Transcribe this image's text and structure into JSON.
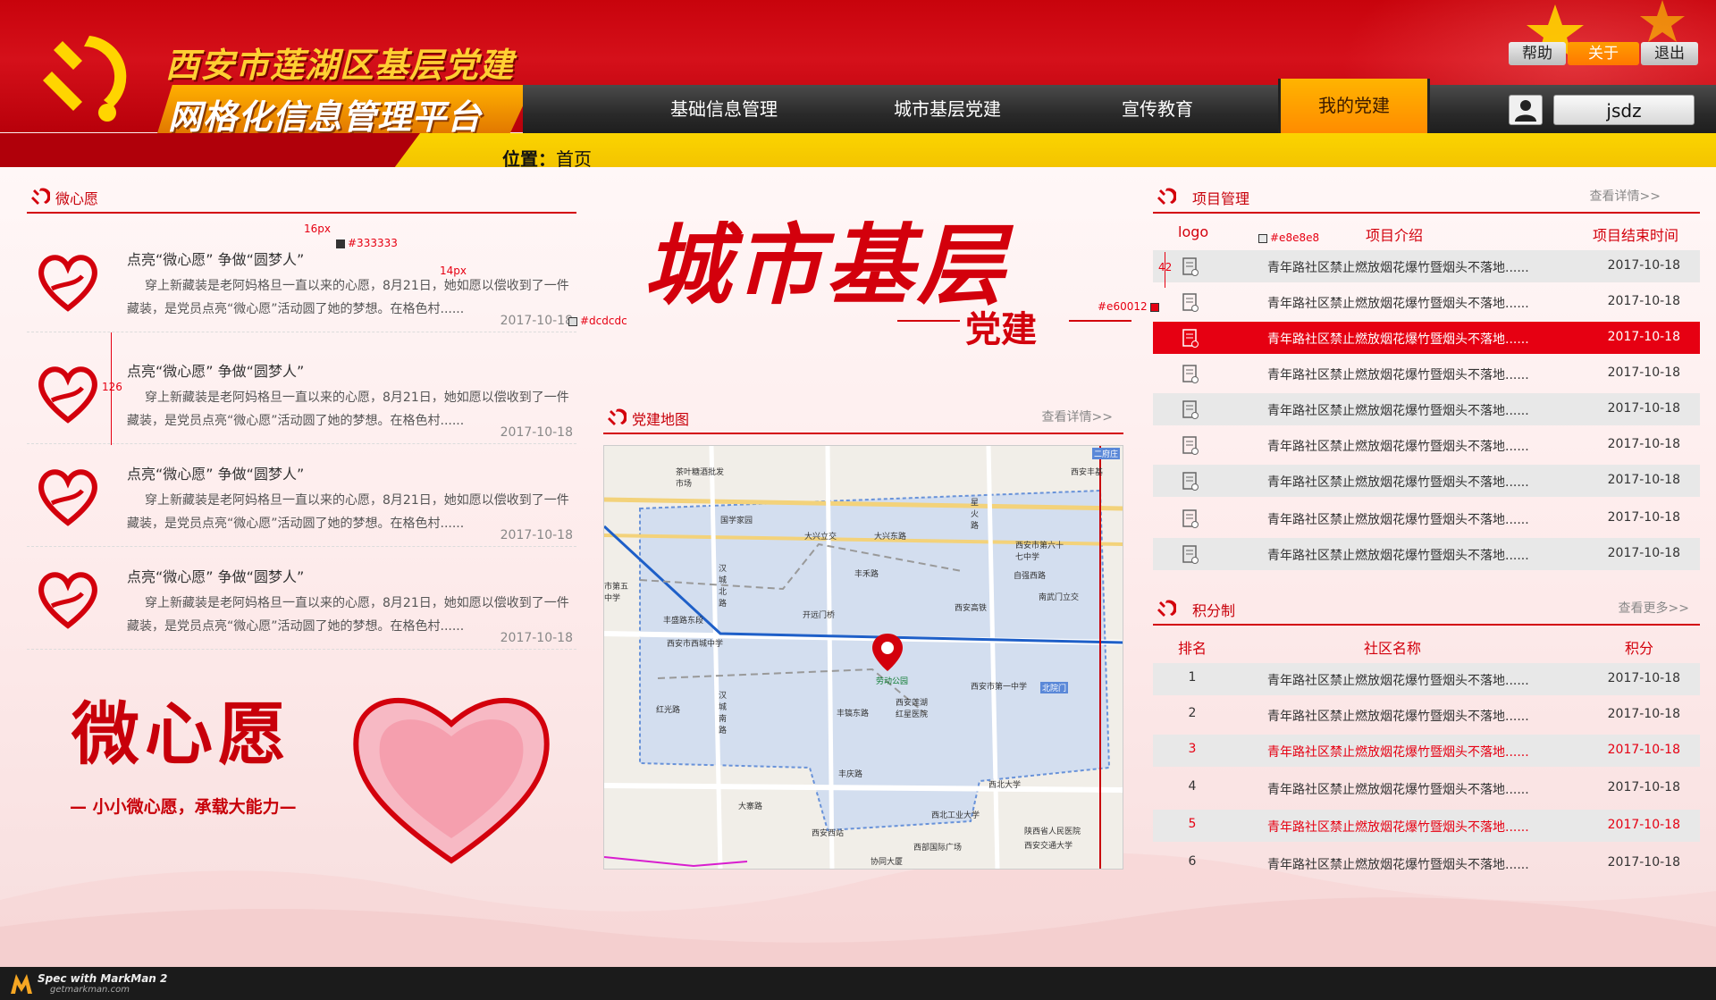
{
  "header": {
    "title_line1": "西安市莲湖区基层党建",
    "title_line2": "网格化信息管理平台",
    "nav": [
      "基础信息管理",
      "城市基层党建",
      "宣传教育",
      "我的党建"
    ],
    "top_buttons": {
      "help": "帮助",
      "about": "关于",
      "exit": "退出"
    },
    "username": "jsdz"
  },
  "location": {
    "label": "位置",
    "separator": "：",
    "value": "首页"
  },
  "wish": {
    "title": "微心愿",
    "items": [
      {
        "title": "点亮“微心愿” 争做“圆梦人”",
        "desc": "穿上新藏装是老阿妈格旦一直以来的心愿，8月21日，她如愿以偿收到了一件藏装，是党员点亮“微心愿”活动圆了她的梦想。在格色村......",
        "date": "2017-10-18"
      },
      {
        "title": "点亮“微心愿” 争做“圆梦人”",
        "desc": "穿上新藏装是老阿妈格旦一直以来的心愿，8月21日，她如愿以偿收到了一件藏装，是党员点亮“微心愿”活动圆了她的梦想。在格色村......",
        "date": "2017-10-18"
      },
      {
        "title": "点亮“微心愿” 争做“圆梦人”",
        "desc": "穿上新藏装是老阿妈格旦一直以来的心愿，8月21日，她如愿以偿收到了一件藏装，是党员点亮“微心愿”活动圆了她的梦想。在格色村......",
        "date": "2017-10-18"
      },
      {
        "title": "点亮“微心愿” 争做“圆梦人”",
        "desc": "穿上新藏装是老阿妈格旦一直以来的心愿，8月21日，她如愿以偿收到了一件藏装，是党员点亮“微心愿”活动圆了她的梦想。在格色村......",
        "date": "2017-10-18"
      }
    ],
    "banner_title": "微心愿",
    "banner_slogan": "— 小小微心愿，承载大能力—"
  },
  "center": {
    "big_title": "城市基层",
    "big_subtitle": "党建",
    "map_title": "党建地图",
    "map_more": "查看详情>>",
    "map_labels": [
      "茶叶糖酒批发市场",
      "国学家园",
      "大兴东路",
      "星火路",
      "西安市第六十七中学",
      "汉城北路",
      "丰禾路",
      "开远门桥",
      "自强西路",
      "西安高铁",
      "南武门立交",
      "丰盛路东段",
      "西安市西城中学",
      "劳动公园",
      "西安市第一中学",
      "北院门",
      "红光路",
      "汉城南路",
      "丰镐东路",
      "西安莲湖红星医院",
      "丰庆路",
      "大寨路",
      "西北工业大学",
      "西北大学",
      "西安交通大学",
      "陕西省人民医院",
      "二府庄",
      "西安丰基",
      "大兴立交",
      "市第五中学",
      "协同大厦",
      "西部国际广场",
      "西安西站"
    ]
  },
  "projects": {
    "title": "项目管理",
    "more": "查看详情>>",
    "headers": [
      "logo",
      "项目介绍",
      "项目结束时间"
    ],
    "rows": [
      {
        "text": "青年路社区禁止燃放烟花爆竹暨烟头不落地......",
        "date": "2017-10-18"
      },
      {
        "text": "青年路社区禁止燃放烟花爆竹暨烟头不落地......",
        "date": "2017-10-18"
      },
      {
        "text": "青年路社区禁止燃放烟花爆竹暨烟头不落地......",
        "date": "2017-10-18"
      },
      {
        "text": "青年路社区禁止燃放烟花爆竹暨烟头不落地......",
        "date": "2017-10-18"
      },
      {
        "text": "青年路社区禁止燃放烟花爆竹暨烟头不落地......",
        "date": "2017-10-18"
      },
      {
        "text": "青年路社区禁止燃放烟花爆竹暨烟头不落地......",
        "date": "2017-10-18"
      },
      {
        "text": "青年路社区禁止燃放烟花爆竹暨烟头不落地......",
        "date": "2017-10-18"
      },
      {
        "text": "青年路社区禁止燃放烟花爆竹暨烟头不落地......",
        "date": "2017-10-18"
      },
      {
        "text": "青年路社区禁止燃放烟花爆竹暨烟头不落地......",
        "date": "2017-10-18"
      }
    ]
  },
  "points": {
    "title": "积分制",
    "more": "查看更多>>",
    "headers": [
      "排名",
      "社区名称",
      "积分"
    ],
    "rows": [
      {
        "rank": "1",
        "text": "青年路社区禁止燃放烟花爆竹暨烟头不落地......",
        "date": "2017-10-18"
      },
      {
        "rank": "2",
        "text": "青年路社区禁止燃放烟花爆竹暨烟头不落地......",
        "date": "2017-10-18"
      },
      {
        "rank": "3",
        "text": "青年路社区禁止燃放烟花爆竹暨烟头不落地......",
        "date": "2017-10-18"
      },
      {
        "rank": "4",
        "text": "青年路社区禁止燃放烟花爆竹暨烟头不落地......",
        "date": "2017-10-18"
      },
      {
        "rank": "5",
        "text": "青年路社区禁止燃放烟花爆竹暨烟头不落地......",
        "date": "2017-10-18"
      },
      {
        "rank": "6",
        "text": "青年路社区禁止燃放烟花爆竹暨烟头不落地......",
        "date": "2017-10-18"
      }
    ]
  },
  "annotations": {
    "a16px": "16px",
    "a333": "#333333",
    "a14px": "14px",
    "adcdcdc": "#dcdcdc",
    "a126": "126",
    "ae8e8e8": "#e8e8e8",
    "a42": "42",
    "ae60012": "#e60012"
  },
  "footer": {
    "brand": "Spec with MarkMan 2",
    "site": "getmarkman.com"
  },
  "colors": {
    "primary_red": "#e60012",
    "gray_row": "#e8e8e8",
    "text": "#333333",
    "divider": "#dcdcdc",
    "accent_orange": "#ff8800",
    "yellow": "#f7cc00"
  }
}
